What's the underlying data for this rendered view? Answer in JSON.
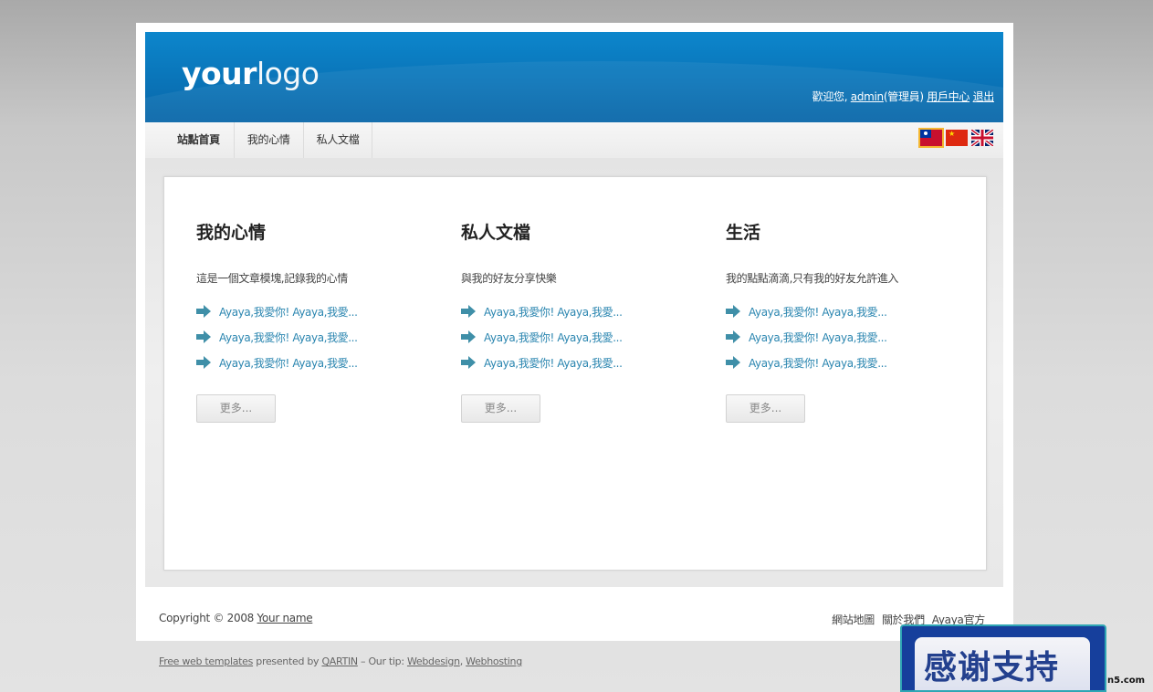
{
  "logo": {
    "bold": "your",
    "thin": "logo"
  },
  "header": {
    "welcome": "歡迎您,",
    "username": "admin",
    "role": "(管理員)",
    "user_center": "用戶中心",
    "logout": "退出"
  },
  "nav": {
    "items": [
      {
        "label": "站點首頁"
      },
      {
        "label": "我的心情"
      },
      {
        "label": "私人文檔"
      }
    ],
    "flags": [
      {
        "icon": "taiwan-flag-icon",
        "active": true
      },
      {
        "icon": "china-flag-icon",
        "active": false
      },
      {
        "icon": "uk-flag-icon",
        "active": false
      }
    ]
  },
  "columns": [
    {
      "title": "我的心情",
      "desc": "這是一個文章模塊,記錄我的心情",
      "links": [
        "Ayaya,我愛你! Ayaya,我愛...",
        "Ayaya,我愛你! Ayaya,我愛...",
        "Ayaya,我愛你! Ayaya,我愛..."
      ],
      "more": "更多..."
    },
    {
      "title": "私人文檔",
      "desc": "與我的好友分享快樂",
      "links": [
        "Ayaya,我愛你! Ayaya,我愛...",
        "Ayaya,我愛你! Ayaya,我愛...",
        "Ayaya,我愛你! Ayaya,我愛..."
      ],
      "more": "更多..."
    },
    {
      "title": "生活",
      "desc": "我的點點滴滴,只有我的好友允許進入",
      "links": [
        "Ayaya,我愛你! Ayaya,我愛...",
        "Ayaya,我愛你! Ayaya,我愛...",
        "Ayaya,我愛你! Ayaya,我愛..."
      ],
      "more": "更多..."
    }
  ],
  "footer": {
    "copyright": "Copyright © 2008",
    "your_name": "Your name",
    "links": [
      "網站地圖",
      "關於我們",
      "Ayaya官方"
    ]
  },
  "credits": {
    "free_templates": "Free web templates",
    "presented_by": " presented by ",
    "qartin": "QARTIN",
    "tip": " – Our tip: ",
    "webdesign": "Webdesign",
    "comma": ", ",
    "webhosting": "Webhosting"
  },
  "overlay": {
    "thanks": "感谢支持",
    "side": "n5.com"
  },
  "colors": {
    "header_blue": "#0a74b8",
    "link_blue": "#2b86b0",
    "flag_highlight": "#f4b731"
  }
}
